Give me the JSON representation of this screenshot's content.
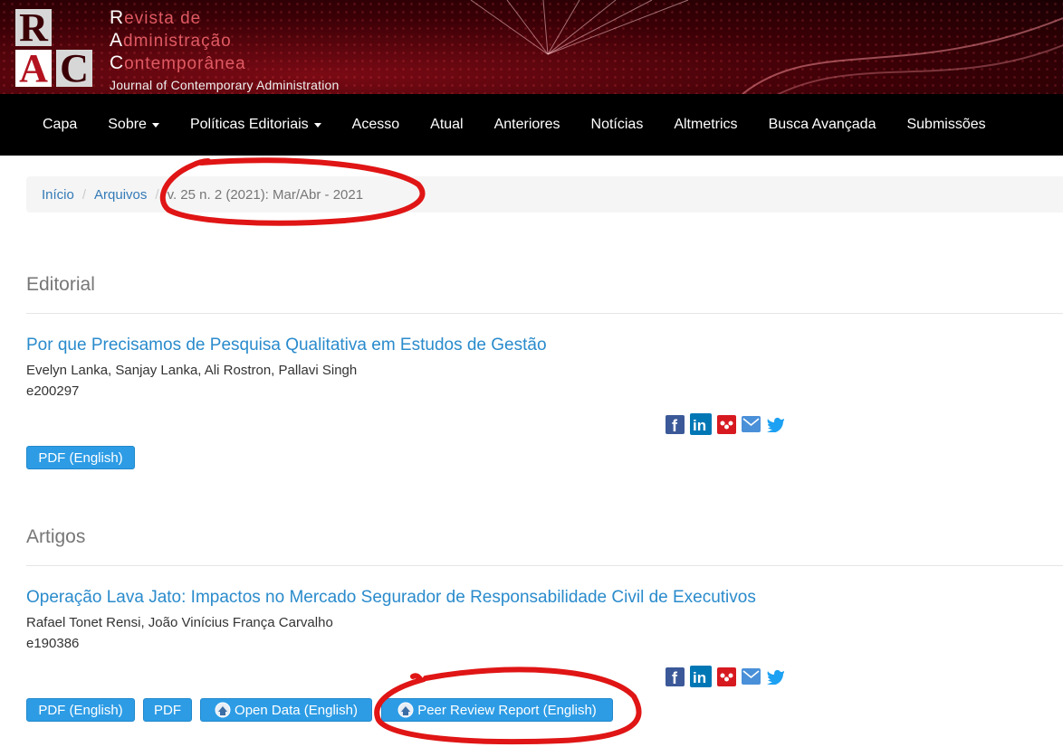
{
  "header": {
    "logo_letters": [
      "R",
      "A",
      "C"
    ],
    "title_lines": [
      {
        "cap": "R",
        "rest": "evista de"
      },
      {
        "cap": "A",
        "rest": "dministração"
      },
      {
        "cap": "C",
        "rest": "ontemporânea"
      }
    ],
    "subtitle": "Journal of Contemporary Administration"
  },
  "nav": {
    "items": [
      {
        "label": "Capa",
        "dropdown": false
      },
      {
        "label": "Sobre",
        "dropdown": true
      },
      {
        "label": "Políticas Editoriais",
        "dropdown": true
      },
      {
        "label": "Acesso",
        "dropdown": false
      },
      {
        "label": "Atual",
        "dropdown": false
      },
      {
        "label": "Anteriores",
        "dropdown": false
      },
      {
        "label": "Notícias",
        "dropdown": false
      },
      {
        "label": "Altmetrics",
        "dropdown": false
      },
      {
        "label": "Busca Avançada",
        "dropdown": false
      },
      {
        "label": "Submissões",
        "dropdown": false
      }
    ]
  },
  "breadcrumb": {
    "home": "Início",
    "archives": "Arquivos",
    "current": "v. 25 n. 2 (2021): Mar/Abr - 2021"
  },
  "sections": {
    "editorial": {
      "title": "Editorial",
      "article": {
        "title": "Por que Precisamos de Pesquisa Qualitativa em Estudos de Gestão",
        "authors": "Evelyn Lanka, Sanjay Lanka, Ali Rostron, Pallavi Singh",
        "id": "e200297",
        "buttons": [
          "PDF (English)"
        ]
      }
    },
    "artigos": {
      "title": "Artigos",
      "article": {
        "title": "Operação Lava Jato: Impactos no Mercado Segurador de Responsabilidade Civil de Executivos",
        "authors": "Rafael Tonet Rensi, João Vinícius França Carvalho",
        "id": "e190386",
        "buttons": [
          "PDF (English)",
          "PDF",
          "Open Data (English)",
          "Peer Review Report (English)"
        ]
      }
    }
  },
  "share_icons": [
    "facebook-icon",
    "linkedin-icon",
    "mendeley-icon",
    "email-icon",
    "twitter-icon"
  ],
  "colors": {
    "accent_link": "#2a8bcc",
    "button_bg": "#2d9ce5",
    "nav_bg": "#000000",
    "header_red": "#7a0a14",
    "annotation_red": "#e01515"
  }
}
